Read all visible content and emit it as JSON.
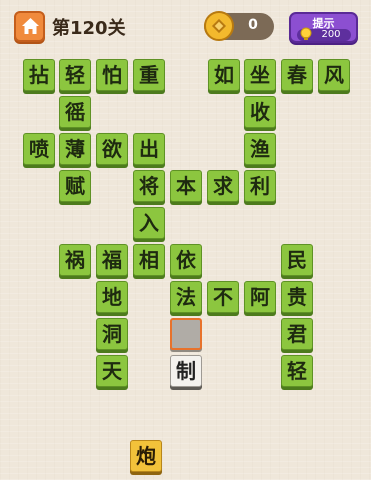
{
  "header": {
    "level_label": "第120关",
    "coins": "0",
    "hint_label": "提示",
    "hint_cost": "200"
  },
  "grid": [
    {
      "ch": "拈",
      "state": "green"
    },
    {
      "ch": "轻",
      "state": "green"
    },
    {
      "ch": "怕",
      "state": "green"
    },
    {
      "ch": "重",
      "state": "green"
    },
    {
      "ch": "如",
      "state": "green"
    },
    {
      "ch": "坐",
      "state": "green"
    },
    {
      "ch": "春",
      "state": "green"
    },
    {
      "ch": "风",
      "state": "green"
    },
    {
      "ch": "徭",
      "state": "green"
    },
    {
      "ch": "收",
      "state": "green"
    },
    {
      "ch": "喷",
      "state": "green"
    },
    {
      "ch": "薄",
      "state": "green"
    },
    {
      "ch": "欲",
      "state": "green"
    },
    {
      "ch": "出",
      "state": "green"
    },
    {
      "ch": "渔",
      "state": "green"
    },
    {
      "ch": "赋",
      "state": "green"
    },
    {
      "ch": "将",
      "state": "green"
    },
    {
      "ch": "本",
      "state": "green"
    },
    {
      "ch": "求",
      "state": "green"
    },
    {
      "ch": "利",
      "state": "green"
    },
    {
      "ch": "入",
      "state": "green"
    },
    {
      "ch": "祸",
      "state": "green"
    },
    {
      "ch": "福",
      "state": "green"
    },
    {
      "ch": "相",
      "state": "green"
    },
    {
      "ch": "依",
      "state": "green"
    },
    {
      "ch": "民",
      "state": "green"
    },
    {
      "ch": "地",
      "state": "green"
    },
    {
      "ch": "法",
      "state": "green"
    },
    {
      "ch": "不",
      "state": "green"
    },
    {
      "ch": "阿",
      "state": "green"
    },
    {
      "ch": "贵",
      "state": "green"
    },
    {
      "ch": "洞",
      "state": "green"
    },
    {
      "ch": "",
      "state": "empty"
    },
    {
      "ch": "君",
      "state": "green"
    },
    {
      "ch": "天",
      "state": "green"
    },
    {
      "ch": "制",
      "state": "filled"
    },
    {
      "ch": "轻",
      "state": "green"
    }
  ],
  "choices": [
    {
      "ch": "炮"
    }
  ]
}
